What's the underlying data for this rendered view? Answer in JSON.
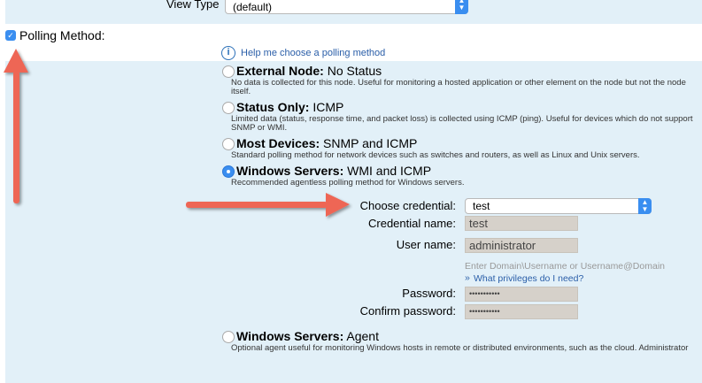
{
  "view_type": {
    "label": "View Type",
    "value": "(default)"
  },
  "polling": {
    "label": "Polling Method:",
    "checked": true,
    "help": "Help me choose a polling method",
    "options": [
      {
        "bold": "External Node:",
        "rest": " No Status",
        "desc": "No data is collected for this node. Useful for monitoring a hosted application or other element on the node but not the node itself.",
        "selected": false
      },
      {
        "bold": "Status Only:",
        "rest": " ICMP",
        "desc": "Limited data (status, response time, and packet loss) is collected using ICMP (ping). Useful for devices which do not support SNMP or WMI.",
        "selected": false
      },
      {
        "bold": "Most Devices:",
        "rest": " SNMP and ICMP",
        "desc": "Standard polling method for network devices such as switches and routers, as well as Linux and Unix servers.",
        "selected": false
      },
      {
        "bold": "Windows Servers:",
        "rest": " WMI and ICMP",
        "desc": "Recommended agentless polling method for Windows servers.",
        "selected": true
      },
      {
        "bold": "Windows Servers:",
        "rest": " Agent",
        "desc": "Optional agent useful for monitoring Windows hosts in remote or distributed environments, such as the cloud. Administrator",
        "selected": false
      }
    ]
  },
  "credential": {
    "choose_label": "Choose credential:",
    "choose_value": "test",
    "name_label": "Credential name:",
    "name_value": "test",
    "user_label": "User name:",
    "user_value": "administrator",
    "user_hint": "Enter Domain\\Username or Username@Domain",
    "privileges_link": "What privileges do I need?",
    "password_label": "Password:",
    "password_value": "•••••••••••",
    "confirm_label": "Confirm password:",
    "confirm_value": "•••••••••••"
  },
  "colors": {
    "accent": "#3a8ef0",
    "arrow": "#ee6655",
    "band": "#e2f0f8"
  }
}
